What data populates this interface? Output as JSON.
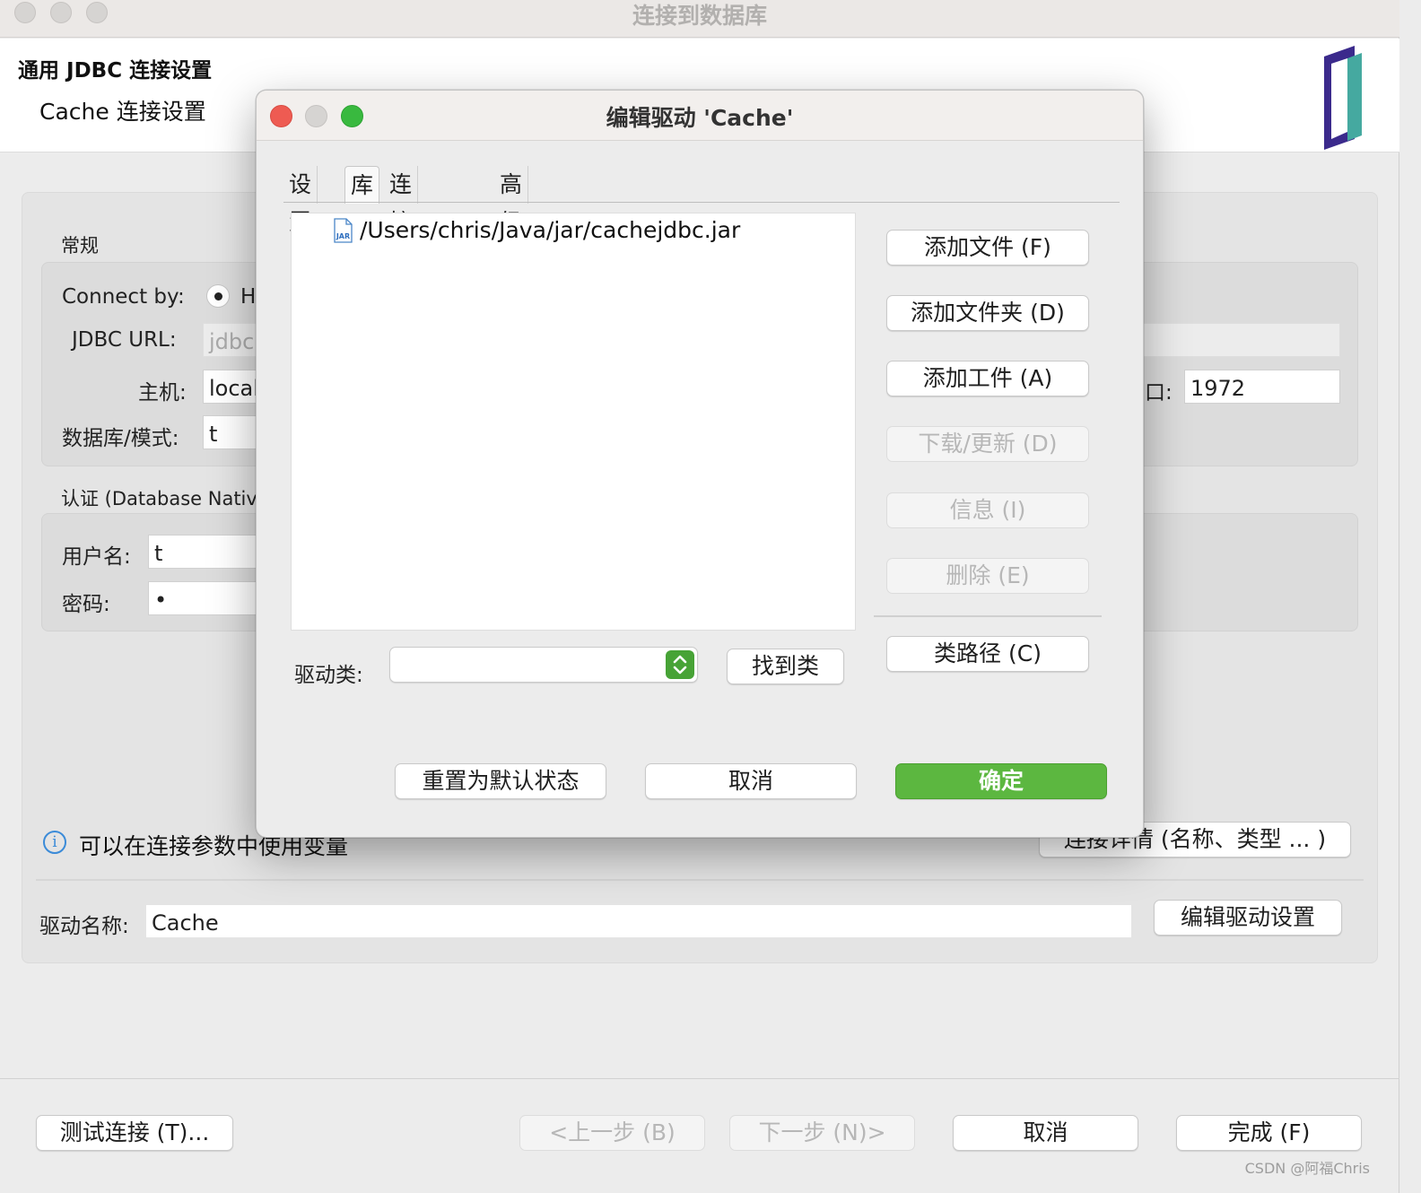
{
  "window": {
    "title": "连接到数据库"
  },
  "header": {
    "title": "通用 JDBC 连接设置",
    "subtitle": "Cache 连接设置"
  },
  "general": {
    "section_label": "常规",
    "connect_by_label": "Connect by:",
    "connect_by_option": "H",
    "jdbc_url_label": "JDBC URL:",
    "jdbc_url_value": "jdbc:",
    "host_label": "主机:",
    "host_value": "local",
    "port_label": "口:",
    "port_value": "1972",
    "database_label": "数据库/模式:",
    "database_value": "t"
  },
  "auth": {
    "section_label": "认证 (Database Nativ",
    "username_label": "用户名:",
    "username_value": "t",
    "password_label": "密码:",
    "password_value": "•"
  },
  "info": {
    "text": "可以在连接参数中使用变量"
  },
  "connection_details_button": "连接详情 (名称、类型 ... )",
  "driver": {
    "name_label": "驱动名称:",
    "name_value": "Cache",
    "edit_button": "编辑驱动设置"
  },
  "footer": {
    "test_button": "测试连接 (T)...",
    "back_button": "<上一步 (B)",
    "next_button": "下一步 (N)>",
    "cancel_button": "取消",
    "finish_button": "完成 (F)"
  },
  "dialog": {
    "title": "编辑驱动 'Cache'",
    "tabs": [
      "设置",
      "库",
      "连接属性",
      "高级参数"
    ],
    "active_tab": "库",
    "libraries": [
      "/Users/chris/Java/jar/cachejdbc.jar"
    ],
    "jar_icon_label": "JAR",
    "buttons": {
      "add_file": "添加文件 (F)",
      "add_folder": "添加文件夹 (D)",
      "add_artifact": "添加工件 (A)",
      "download_update": "下载/更新 (D)",
      "info": "信息 (I)",
      "delete": "删除 (E)",
      "classpath": "类路径 (C)",
      "find_class": "找到类",
      "reset": "重置为默认状态",
      "cancel": "取消",
      "ok": "确定"
    },
    "driver_class_label": "驱动类:",
    "driver_class_value": ""
  },
  "watermark": "CSDN @阿福Chris",
  "colors": {
    "ok_button": "#5cb740",
    "close": "#ee5b52",
    "minimize": "#d6d4d2",
    "zoom": "#39b93f",
    "logo_dark": "#3b2a8c",
    "logo_teal": "#45a9a0"
  }
}
